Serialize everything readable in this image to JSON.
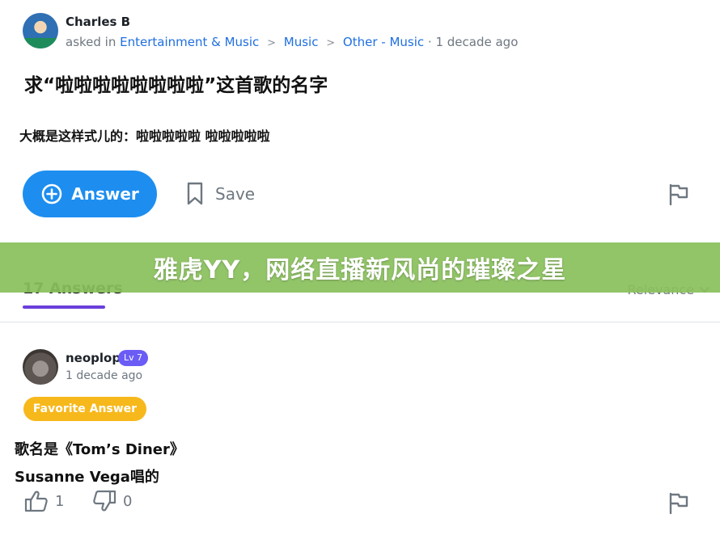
{
  "question": {
    "author": "Charles B",
    "meta_prefix": "asked in",
    "breadcrumb": [
      "Entertainment & Music",
      "Music",
      "Other - Music"
    ],
    "breadcrumb_separator": ">",
    "time": "· 1 decade ago",
    "title": "求“啦啦啦啦啦啦啦啦”这首歌的名字",
    "body": "大概是这样式儿的：啦啦啦啦啦 啦啦啦啦啦"
  },
  "actions": {
    "answer_label": "Answer",
    "save_label": "Save"
  },
  "banner": {
    "text": "雅虎YY，网络直播新风尚的璀璨之星"
  },
  "answers_header": {
    "count_label": "17 Answers",
    "sort_label": "Relevance"
  },
  "answer": {
    "author": "neoplop",
    "level": "Lv 7",
    "time": "1 decade ago",
    "badge": "Favorite Answer",
    "line1": "歌名是《Tom’s Diner》",
    "line2": "Susanne Vega唱的",
    "upvotes": "1",
    "downvotes": "0"
  },
  "colors": {
    "primary_blue": "#1d8ef0",
    "link_blue": "#1f6fe0",
    "banner_green": "#8abf5c",
    "tab_underline": "#6a3fdc",
    "level_badge": "#6a5cf5",
    "favorite_badge": "#f7b81b"
  },
  "icons": [
    "plus-circle-icon",
    "bookmark-icon",
    "flag-icon",
    "chevron-down-icon",
    "thumbs-up-icon",
    "thumbs-down-icon"
  ]
}
